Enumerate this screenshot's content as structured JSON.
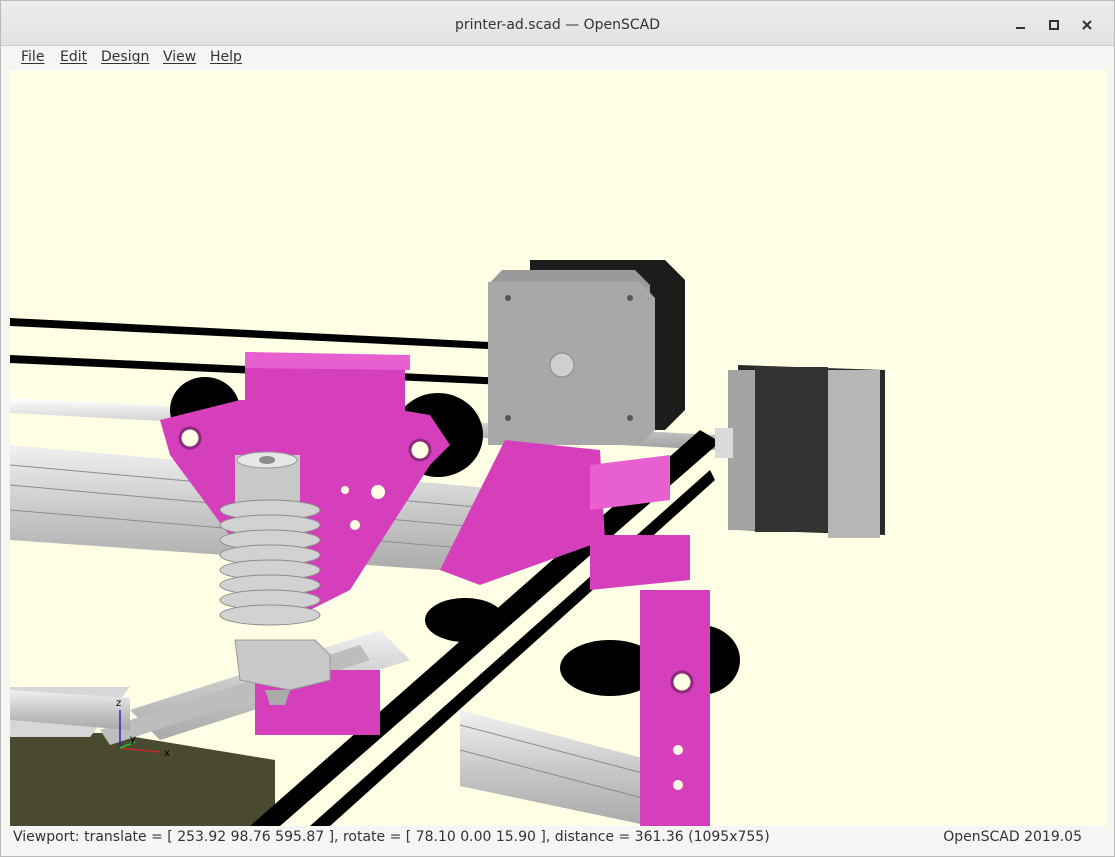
{
  "window": {
    "title": "printer-ad.scad — OpenSCAD",
    "controls": {
      "minimize_icon": "minimize-icon",
      "maximize_icon": "maximize-icon",
      "close_icon": "close-icon"
    }
  },
  "menubar": {
    "items": [
      "File",
      "Edit",
      "Design",
      "View",
      "Help"
    ]
  },
  "viewport": {
    "background_color": "#ffffe5",
    "part_color": "#d63fbb",
    "axis_labels": {
      "x": "x",
      "y": "y",
      "z": "z"
    }
  },
  "statusbar": {
    "viewport_text": "Viewport: translate = [ 253.92 98.76 595.87 ], rotate = [ 78.10 0.00 15.90 ], distance = 361.36 (1095x755)",
    "version": "OpenSCAD 2019.05"
  }
}
